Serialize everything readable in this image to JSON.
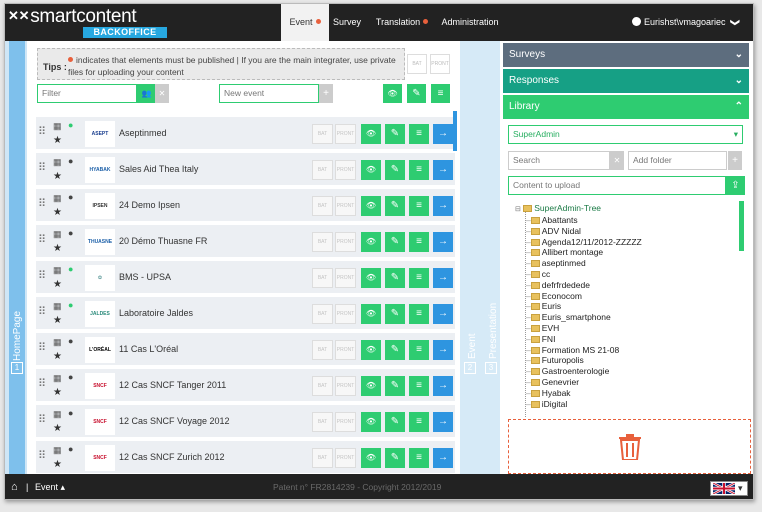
{
  "brand": {
    "name": "smartcontent",
    "sub": "BACKOFFICE",
    "mark": "✕✕"
  },
  "nav": {
    "tabs": [
      {
        "label": "Event",
        "dot": true,
        "active": true
      },
      {
        "label": "Survey",
        "dot": false,
        "active": false
      },
      {
        "label": "Translation",
        "dot": true,
        "active": false
      },
      {
        "label": "Administration",
        "dot": false,
        "active": false
      }
    ],
    "user": "Eurishst\\vmagoariec",
    "user_chevron": "❯"
  },
  "left_strip": {
    "label": "HomePage",
    "num": "1"
  },
  "mid_strips": [
    {
      "label": "Event",
      "num": "2"
    },
    {
      "label": "Presentation",
      "num": "3"
    }
  ],
  "tips": {
    "title": "Tips :",
    "text": "indicates that elements must be published | If you are the main integrater, use private files for uploading your content",
    "bat": "BAT",
    "pront": "PRONT"
  },
  "filter": {
    "placeholder": "Filter",
    "new_event_placeholder": "New event"
  },
  "icons": {
    "eye": "👁",
    "edit": "✎",
    "sliders": "≡",
    "arrow": "→",
    "star": "★",
    "user": "👤",
    "calendar": "▦",
    "drag": "⠿",
    "plus": "+",
    "times": "✕",
    "users": "👥",
    "upload": "⇪",
    "trash": "🗑",
    "home": "⌂",
    "caret": "▴",
    "dropdown": "▾"
  },
  "events": [
    {
      "name": "Aseptinmed",
      "thumb": "ASEPT",
      "thumb_color": "#1b3f8f",
      "published": true
    },
    {
      "name": "Sales Aid Thea Italy",
      "thumb": "HYABAK",
      "thumb_color": "#1b5fa8",
      "published": false
    },
    {
      "name": "24 Demo Ipsen",
      "thumb": "IPSEN",
      "thumb_color": "#333",
      "published": false
    },
    {
      "name": "20 Démo Thuasne FR",
      "thumb": "THUASNE",
      "thumb_color": "#1b5fa8",
      "published": false
    },
    {
      "name": "BMS - UPSA",
      "thumb": "✿",
      "thumb_color": "#7aa",
      "published": true
    },
    {
      "name": "Laboratoire Jaldes",
      "thumb": "JALDES",
      "thumb_color": "#2a8a7a",
      "published": true
    },
    {
      "name": "11 Cas L'Oréal",
      "thumb": "L'ORÉAL",
      "thumb_color": "#000",
      "published": false
    },
    {
      "name": "12 Cas SNCF Tanger 2011",
      "thumb": "SNCF",
      "thumb_color": "#c8102e",
      "published": false
    },
    {
      "name": "12 Cas SNCF Voyage 2012",
      "thumb": "SNCF",
      "thumb_color": "#c8102e",
      "published": false
    },
    {
      "name": "12 Cas SNCF Zurich 2012",
      "thumb": "SNCF",
      "thumb_color": "#c8102e",
      "published": false
    }
  ],
  "panels": {
    "surveys": "Surveys",
    "responses": "Responses",
    "library": "Library",
    "surveys_color": "#5d6d7e",
    "responses_color": "#16a085",
    "library_color": "#2ecc71"
  },
  "library": {
    "select": "SuperAdmin",
    "search_placeholder": "Search",
    "add_folder_placeholder": "Add folder",
    "upload_placeholder": "Content to upload",
    "root": "SuperAdmin-Tree",
    "folders": [
      "Abattants",
      "ADV Nidal",
      "Agenda12/11/2012-ZZZZZ",
      "Allibert montage",
      "aseptinmed",
      "cc",
      "defrfrdedede",
      "Econocom",
      "Euris",
      "Euris_smartphone",
      "EVH",
      "FNI",
      "Formation MS 21-08",
      "Futuropolis",
      "Gastroenterologie",
      "Genevrier",
      "Hyabak",
      "iDigital"
    ]
  },
  "footer": {
    "section": "Event",
    "separator": "|",
    "copyright": "Patent n° FR2814239 - Copyright 2012/2019"
  }
}
